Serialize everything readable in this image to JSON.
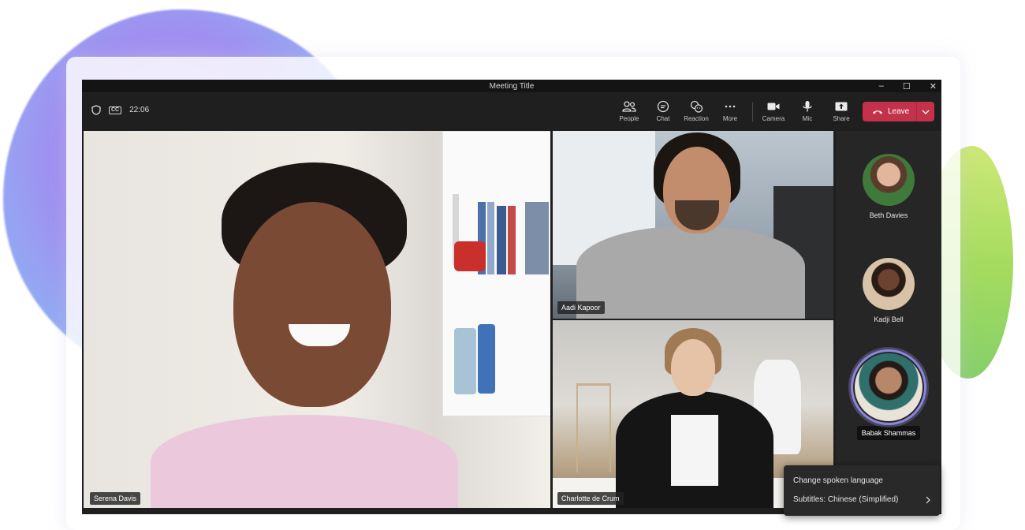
{
  "window": {
    "title": "Meeting Title",
    "controls": [
      "–",
      "☐",
      "✕"
    ]
  },
  "toolbar": {
    "timer": "22:06",
    "cc_label": "CC",
    "buttons": {
      "people": "People",
      "chat": "Chat",
      "reaction": "Reaction",
      "more": "More",
      "camera": "Camera",
      "mic": "Mic",
      "share": "Share"
    },
    "leave_label": "Leave",
    "leave_color": "#c4314b"
  },
  "stage": {
    "tiles": [
      {
        "name": "Serena Davis"
      },
      {
        "name": "Aadi Kapoor"
      },
      {
        "name": "Charlotte de Crum"
      }
    ]
  },
  "roster": {
    "participants": [
      {
        "name": "Beth Davies",
        "speaking": false
      },
      {
        "name": "Kadji Bell",
        "speaking": false
      },
      {
        "name": "Babak Shammas",
        "speaking": true
      }
    ],
    "active_ring_color": "#8c86d9"
  },
  "context_menu": {
    "items": [
      {
        "label": "Change spoken language",
        "has_submenu": false
      },
      {
        "label": "Subtitles: Chinese (Simplified)",
        "has_submenu": true
      }
    ]
  }
}
